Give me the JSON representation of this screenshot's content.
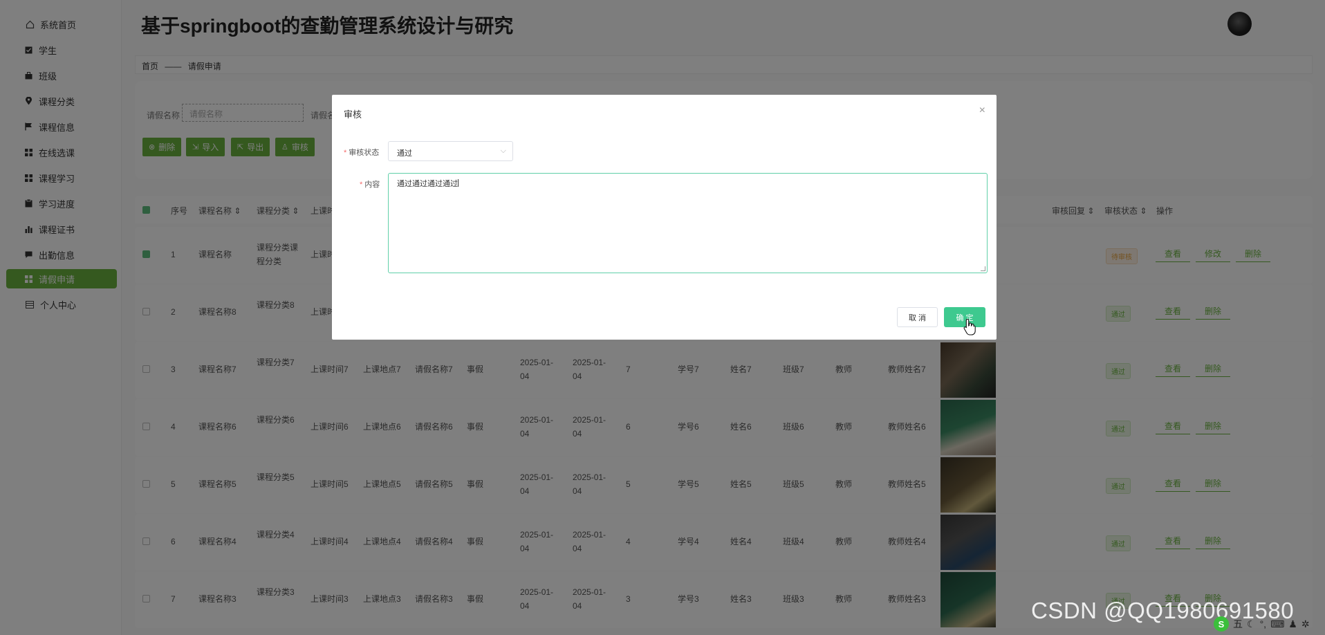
{
  "app": {
    "title": "基于springboot的查勤管理系统设计与研究"
  },
  "sidebar": {
    "items": [
      {
        "label": "系统首页",
        "icon": "home-icon"
      },
      {
        "label": "学生",
        "icon": "check-square-icon"
      },
      {
        "label": "班级",
        "icon": "briefcase-icon"
      },
      {
        "label": "课程分类",
        "icon": "location-pin-icon"
      },
      {
        "label": "课程信息",
        "icon": "flag-icon"
      },
      {
        "label": "在线选课",
        "icon": "grid-icon"
      },
      {
        "label": "课程学习",
        "icon": "grid-icon"
      },
      {
        "label": "学习进度",
        "icon": "clipboard-icon"
      },
      {
        "label": "课程证书",
        "icon": "bar-chart-icon"
      },
      {
        "label": "出勤信息",
        "icon": "chat-icon"
      },
      {
        "label": "请假申请",
        "icon": "grid-icon"
      },
      {
        "label": "个人中心",
        "icon": "calendar-icon"
      }
    ],
    "active": "请假申请"
  },
  "breadcrumb": {
    "home": "首页",
    "sep": "——",
    "current": "请假申请"
  },
  "search": {
    "label1": "请假名称",
    "placeholder1": "请假名称",
    "label2": "请假名"
  },
  "toolbar": {
    "delete": "删除",
    "import": "导入",
    "export": "导出",
    "audit": "审核"
  },
  "table": {
    "headers": {
      "index": "序号",
      "course_name": "课程名称",
      "course_cat": "课程分类",
      "class_time": "上课时",
      "reply": "审核回复",
      "status": "审核状态",
      "action": "操作"
    },
    "rows": [
      {
        "no": "1",
        "course": "课程名称",
        "cat": "课程分类课程分类",
        "time": "上课时",
        "place": "",
        "leave": "",
        "type": "",
        "start": "",
        "end": "",
        "days": "",
        "sno": "",
        "name": "",
        "cls": "",
        "teacher": "",
        "tname": "",
        "status": "待审核",
        "ops": [
          "查看",
          "修改",
          "删除"
        ],
        "checked": true
      },
      {
        "no": "2",
        "course": "课程名称8",
        "cat": "课程分类8",
        "time": "上课时",
        "place": "",
        "leave": "",
        "type": "",
        "start": "",
        "end": "",
        "days": "",
        "sno": "",
        "name": "",
        "cls": "",
        "teacher": "",
        "tname": "",
        "status": "通过",
        "ops": [
          "查看",
          "删除"
        ],
        "checked": false
      },
      {
        "no": "3",
        "course": "课程名称7",
        "cat": "课程分类7",
        "time": "上课时间7",
        "place": "上课地点7",
        "leave": "请假名称7",
        "type": "事假",
        "start": "2025-01-04",
        "end": "2025-01-04",
        "days": "7",
        "sno": "学号7",
        "name": "姓名7",
        "cls": "班级7",
        "teacher": "教师",
        "tname": "教师姓名7",
        "status": "通过",
        "ops": [
          "查看",
          "删除"
        ],
        "checked": false
      },
      {
        "no": "4",
        "course": "课程名称6",
        "cat": "课程分类6",
        "time": "上课时间6",
        "place": "上课地点6",
        "leave": "请假名称6",
        "type": "事假",
        "start": "2025-01-04",
        "end": "2025-01-04",
        "days": "6",
        "sno": "学号6",
        "name": "姓名6",
        "cls": "班级6",
        "teacher": "教师",
        "tname": "教师姓名6",
        "status": "通过",
        "ops": [
          "查看",
          "删除"
        ],
        "checked": false
      },
      {
        "no": "5",
        "course": "课程名称5",
        "cat": "课程分类5",
        "time": "上课时间5",
        "place": "上课地点5",
        "leave": "请假名称5",
        "type": "事假",
        "start": "2025-01-04",
        "end": "2025-01-04",
        "days": "5",
        "sno": "学号5",
        "name": "姓名5",
        "cls": "班级5",
        "teacher": "教师",
        "tname": "教师姓名5",
        "status": "通过",
        "ops": [
          "查看",
          "删除"
        ],
        "checked": false
      },
      {
        "no": "6",
        "course": "课程名称4",
        "cat": "课程分类4",
        "time": "上课时间4",
        "place": "上课地点4",
        "leave": "请假名称4",
        "type": "事假",
        "start": "2025-01-04",
        "end": "2025-01-04",
        "days": "4",
        "sno": "学号4",
        "name": "姓名4",
        "cls": "班级4",
        "teacher": "教师",
        "tname": "教师姓名4",
        "status": "通过",
        "ops": [
          "查看",
          "删除"
        ],
        "checked": false
      },
      {
        "no": "7",
        "course": "课程名称3",
        "cat": "课程分类3",
        "time": "上课时间3",
        "place": "上课地点3",
        "leave": "请假名称3",
        "type": "事假",
        "start": "2025-01-04",
        "end": "2025-01-04",
        "days": "3",
        "sno": "学号3",
        "name": "姓名3",
        "cls": "班级3",
        "teacher": "教师",
        "tname": "教师姓名3",
        "status": "通过",
        "ops": [
          "查看",
          "删除"
        ],
        "checked": false
      }
    ]
  },
  "dialog": {
    "title": "审核",
    "status_label": "审核状态",
    "status_value": "通过",
    "content_label": "内容",
    "content_value": "通过通过通过通过",
    "cancel": "取 消",
    "ok": "确 定"
  },
  "watermark": "CSDN @QQ1980691580",
  "tray": {
    "ime": "五"
  },
  "colors": {
    "primary": "#6ab33f",
    "confirm": "#3ec98f",
    "required": "#f56c6c"
  }
}
